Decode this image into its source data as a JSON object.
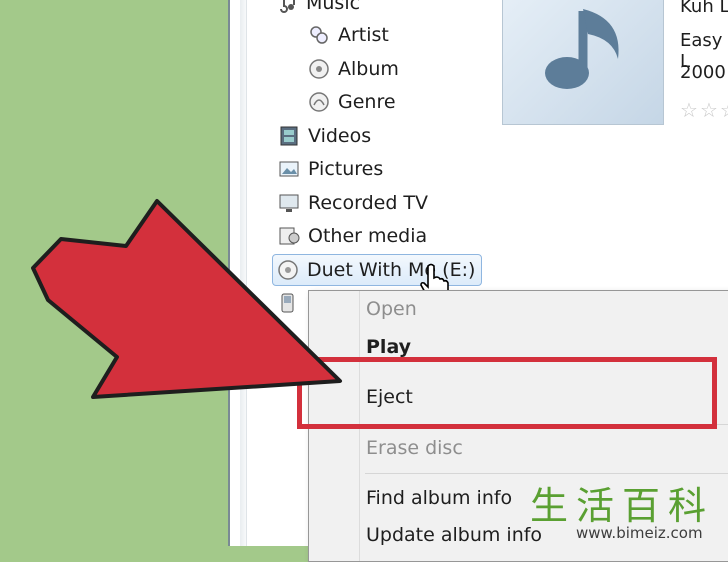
{
  "nav": {
    "items": [
      {
        "label": "Music",
        "icon": "music-notes-icon"
      },
      {
        "label": "Artist",
        "icon": "artist-icon"
      },
      {
        "label": "Album",
        "icon": "album-disc-icon"
      },
      {
        "label": "Genre",
        "icon": "genre-icon"
      },
      {
        "label": "Videos",
        "icon": "film-icon"
      },
      {
        "label": "Pictures",
        "icon": "picture-icon"
      },
      {
        "label": "Recorded TV",
        "icon": "tv-icon"
      },
      {
        "label": "Other media",
        "icon": "other-media-icon"
      },
      {
        "label": "Duet With Me (E:)",
        "icon": "disc-drive-icon"
      }
    ]
  },
  "album": {
    "artist": "Kuh L",
    "title": "Easy L",
    "year": "2000"
  },
  "context_menu": {
    "items": [
      "Open",
      "Play",
      "Eject",
      "Erase disc",
      "Find album info",
      "Update album info"
    ]
  },
  "watermark": {
    "chars": [
      "生",
      "活",
      "百",
      "科"
    ],
    "url": "www.bimeiz.com"
  },
  "colors": {
    "background_green": "#a3c98a",
    "arrow_red": "#d3303c",
    "selection_blue": "#dcebfa"
  }
}
